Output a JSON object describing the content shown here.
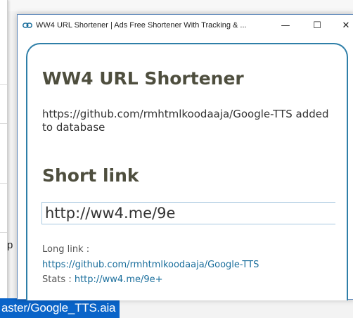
{
  "background": {
    "fragment_text": "p",
    "selected_file": "aster/Google_TTS.aia"
  },
  "window": {
    "title": "WW4 URL Shortener | Ads Free Shortener With Tracking & ...",
    "icon": "chain-link-icon",
    "minimize": "—",
    "maximize": "☐",
    "close": "✕"
  },
  "popup": {
    "heading": "WW4 URL Shortener",
    "message": "https://github.com/rmhtmlkoodaaja/Google-TTS added to database",
    "short_heading": "Short link",
    "short_link_value": "http://ww4.me/9e",
    "long_label": "Long link :",
    "long_link": "https://github.com/rmhtmlkoodaaja/Google-TTS",
    "stats_label": "Stats :",
    "stats_link": "http://ww4.me/9e+"
  },
  "colors": {
    "card_border": "#2f7fa8",
    "link": "#1a6e9c",
    "heading": "#4e4e3e",
    "selection": "#0a64c9"
  }
}
